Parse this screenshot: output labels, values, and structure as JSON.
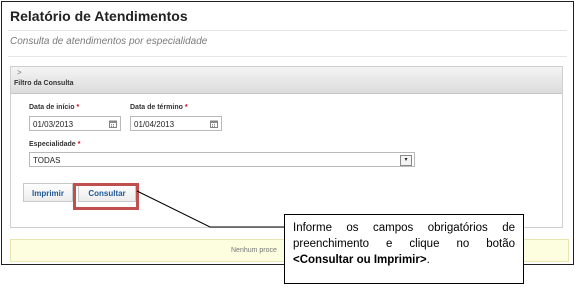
{
  "page": {
    "title": "Relatório de Atendimentos",
    "subtitle": "Consulta de atendimentos por especialidade"
  },
  "panel": {
    "collapse_icon": "chevron-right-icon",
    "title": "Filtro da Consulta"
  },
  "form": {
    "start_date": {
      "label": "Data de início",
      "required_mark": "*",
      "value": "01/03/2013",
      "icon": "calendar-icon"
    },
    "end_date": {
      "label": "Data de término",
      "required_mark": "*",
      "value": "01/04/2013",
      "icon": "calendar-icon"
    },
    "specialty": {
      "label": "Especialidade",
      "required_mark": "*",
      "value": "TODAS",
      "arrow": "▾"
    }
  },
  "buttons": {
    "print_label": "Imprimir",
    "consult_label": "Consultar"
  },
  "message_bar": {
    "text": "Nenhum proce"
  },
  "callout": {
    "line1": "Informe os campos obrigatórios de preenchimento e clique no botão ",
    "emph": "<Consultar ou Imprimir>",
    "end": "."
  },
  "colors": {
    "highlight_border": "#c0504d",
    "button_text": "#1f5a97",
    "required": "#d0021b",
    "message_bg": "#fdfde0"
  }
}
